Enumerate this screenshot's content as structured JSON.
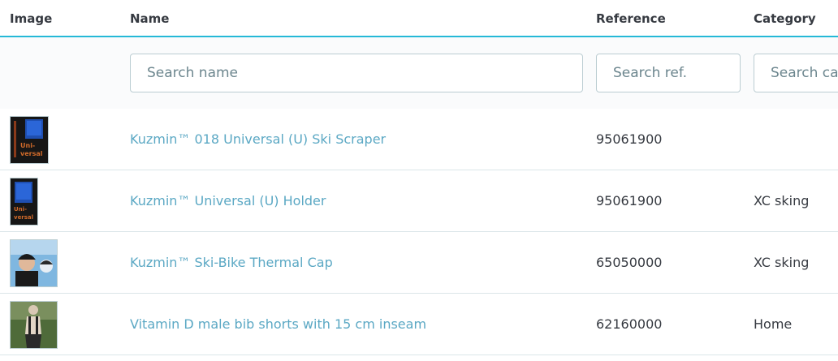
{
  "table": {
    "headers": {
      "image": "Image",
      "name": "Name",
      "reference": "Reference",
      "category": "Category"
    },
    "filters": {
      "name_placeholder": "Search name",
      "ref_placeholder": "Search ref.",
      "cat_placeholder": "Search category"
    },
    "rows": [
      {
        "name": "Kuzmin™ 018 Universal (U) Ski Scraper",
        "reference": "95061900",
        "category": ""
      },
      {
        "name": "Kuzmin™ Universal (U) Holder",
        "reference": "95061900",
        "category": "XC sking"
      },
      {
        "name": "Kuzmin™ Ski-Bike Thermal Cap",
        "reference": "65050000",
        "category": "XC sking"
      },
      {
        "name": "Vitamin D male bib shorts with 15 cm inseam",
        "reference": "62160000",
        "category": "Home"
      }
    ]
  },
  "colors": {
    "accent": "#25b9d7",
    "link": "#5ba8c4",
    "text": "#363a41"
  }
}
